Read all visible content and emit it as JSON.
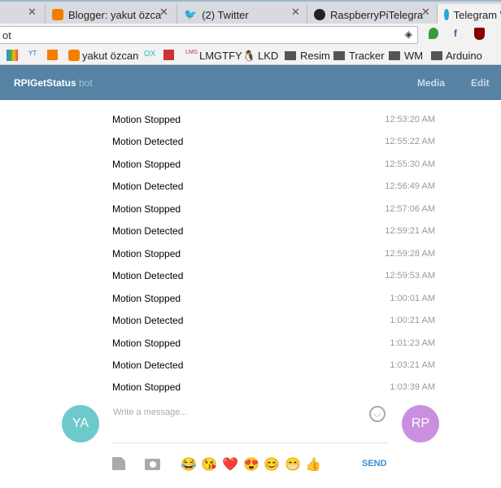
{
  "browser": {
    "tabs": [
      {
        "title": "",
        "icon": "blank"
      },
      {
        "title": "Blogger: yakut özca",
        "icon": "blogger-icon"
      },
      {
        "title": "(2) Twitter",
        "icon": "twitter-icon"
      },
      {
        "title": "RaspberryPiTelegra",
        "icon": "github-icon"
      },
      {
        "title": "Telegram W",
        "icon": "telegram-icon"
      }
    ],
    "url": "ot",
    "bookmarks": [
      "yakut özcan",
      "LMGTFY",
      "LKD",
      "Resim",
      "Tracker",
      "WM",
      "Arduino"
    ]
  },
  "header": {
    "title": "RPIGetStatus",
    "subtitle": "bot",
    "media": "Media",
    "edit": "Edit"
  },
  "messages": [
    {
      "text": "Motion Stopped",
      "time": "12:53:20 AM"
    },
    {
      "text": "Motion Detected",
      "time": "12:55:22 AM"
    },
    {
      "text": "Motion Stopped",
      "time": "12:55:30 AM"
    },
    {
      "text": "Motion Detected",
      "time": "12:56:49 AM"
    },
    {
      "text": "Motion Stopped",
      "time": "12:57:06 AM"
    },
    {
      "text": "Motion Detected",
      "time": "12:59:21 AM"
    },
    {
      "text": "Motion Stopped",
      "time": "12:59:28 AM"
    },
    {
      "text": "Motion Detected",
      "time": "12:59:53 AM"
    },
    {
      "text": "Motion Stopped",
      "time": "1:00:01 AM"
    },
    {
      "text": "Motion Detected",
      "time": "1:00:21 AM"
    },
    {
      "text": "Motion Stopped",
      "time": "1:01:23 AM"
    },
    {
      "text": "Motion Detected",
      "time": "1:03:21 AM"
    },
    {
      "text": "Motion Stopped",
      "time": "1:03:39 AM"
    }
  ],
  "composer": {
    "placeholder": "Write a message...",
    "send": "SEND",
    "user_avatar": "YA",
    "bot_avatar": "RP",
    "emojis": [
      "😂",
      "😘",
      "❤️",
      "😍",
      "😊",
      "😁",
      "👍"
    ]
  },
  "colors": {
    "header": "#5682a3",
    "user_avatar": "#6ec9cb",
    "bot_avatar": "#cb8fe0",
    "send": "#3a8fd0"
  }
}
